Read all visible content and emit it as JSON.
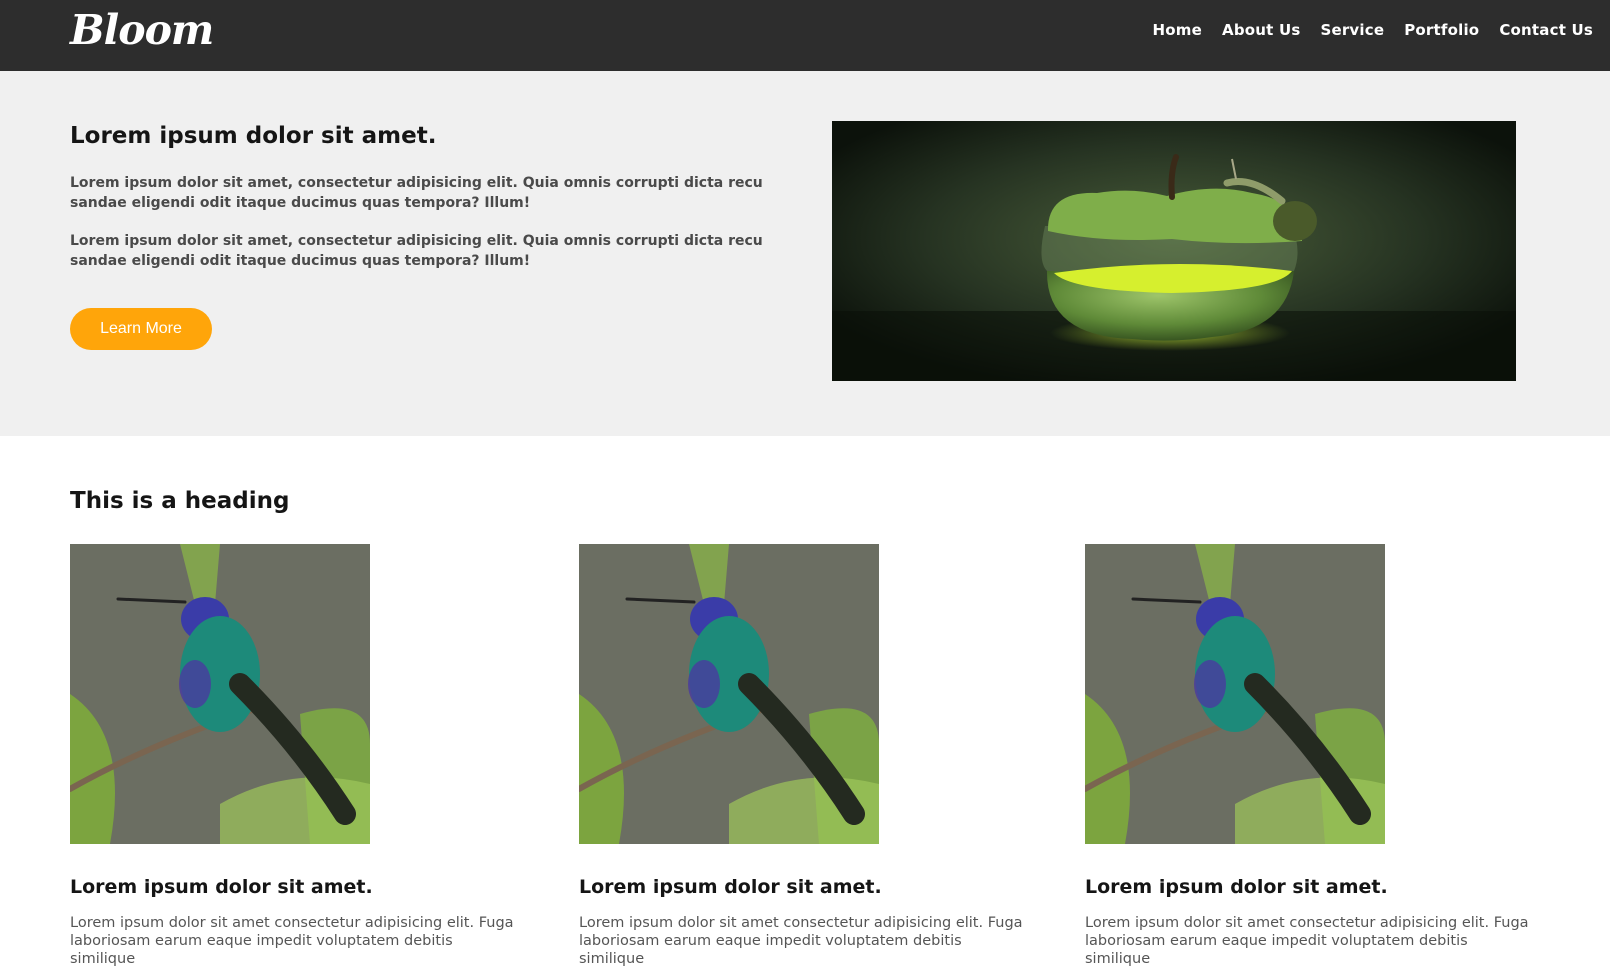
{
  "header": {
    "logo": "Bloom",
    "nav": [
      "Home",
      "About Us",
      "Service",
      "Portfolio",
      "Contact Us"
    ]
  },
  "hero": {
    "title": "Lorem ipsum dolor sit amet.",
    "paragraph1": "Lorem ipsum dolor sit amet, consectetur adipisicing elit. Quia omnis corrupti dicta recu sandae eligendi odit itaque ducimus quas tempora? Illum!",
    "paragraph2": "Lorem ipsum dolor sit amet, consectetur adipisicing elit. Quia omnis corrupti dicta recu sandae eligendi odit itaque ducimus quas tempora? Illum!",
    "button": "Learn More"
  },
  "section": {
    "heading": "This is a heading",
    "cards": [
      {
        "title": "Lorem ipsum dolor sit amet.",
        "text": "Lorem ipsum dolor sit amet consectetur adipisicing elit. Fuga laboriosam earum eaque impedit voluptatem debitis similique"
      },
      {
        "title": "Lorem ipsum dolor sit amet.",
        "text": "Lorem ipsum dolor sit amet consectetur adipisicing elit. Fuga laboriosam earum eaque impedit voluptatem debitis similique"
      },
      {
        "title": "Lorem ipsum dolor sit amet.",
        "text": "Lorem ipsum dolor sit amet consectetur adipisicing elit. Fuga laboriosam earum eaque impedit voluptatem debitis similique"
      }
    ]
  },
  "colors": {
    "header_bg": "#2d2d2d",
    "hero_bg": "#f0f0f0",
    "accent": "#ffa50a"
  }
}
